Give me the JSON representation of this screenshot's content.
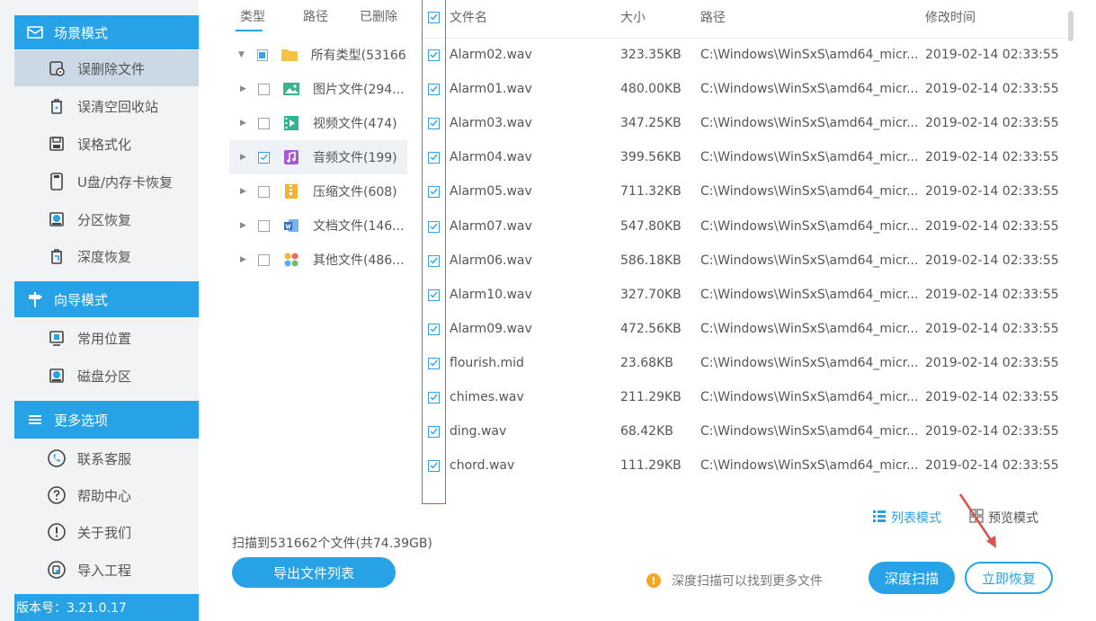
{
  "sidebar": {
    "scene_mode": {
      "title": "场景模式",
      "icon": "mail-icon"
    },
    "scene_items": [
      {
        "label": "误删除文件",
        "icon": "deleted-file-icon",
        "active": true
      },
      {
        "label": "误清空回收站",
        "icon": "recycle-bin-icon",
        "active": false
      },
      {
        "label": "误格式化",
        "icon": "format-icon",
        "active": false
      },
      {
        "label": "U盘/内存卡恢复",
        "icon": "usb-drive-icon",
        "active": false
      },
      {
        "label": "分区恢复",
        "icon": "partition-icon",
        "active": false
      },
      {
        "label": "深度恢复",
        "icon": "deep-recovery-icon",
        "active": false
      }
    ],
    "guide_mode": {
      "title": "向导模式",
      "icon": "signpost-icon"
    },
    "guide_items": [
      {
        "label": "常用位置",
        "icon": "common-location-icon"
      },
      {
        "label": "磁盘分区",
        "icon": "disk-partition-icon"
      }
    ],
    "more_options": {
      "title": "更多选项",
      "icon": "menu-icon"
    },
    "more_items": [
      {
        "label": "联系客服",
        "icon": "phone-icon"
      },
      {
        "label": "帮助中心",
        "icon": "help-icon"
      },
      {
        "label": "关于我们",
        "icon": "info-icon"
      },
      {
        "label": "导入工程",
        "icon": "import-icon"
      }
    ],
    "version": "版本号：3.21.0.17"
  },
  "tree": {
    "tabs": [
      "类型",
      "路径",
      "已删除"
    ],
    "items": [
      {
        "label": "所有类型(53166...",
        "icon": "folder-icon",
        "check": "partial",
        "expanded": true,
        "level": 0
      },
      {
        "label": "图片文件(294...",
        "icon": "image-file-icon",
        "check": "none",
        "level": 1
      },
      {
        "label": "视频文件(474)",
        "icon": "video-file-icon",
        "check": "none",
        "level": 1
      },
      {
        "label": "音频文件(199)",
        "icon": "audio-file-icon",
        "check": "checked",
        "level": 1,
        "selected": true
      },
      {
        "label": "压缩文件(608)",
        "icon": "archive-file-icon",
        "check": "none",
        "level": 1
      },
      {
        "label": "文档文件(146...",
        "icon": "document-file-icon",
        "check": "none",
        "level": 1
      },
      {
        "label": "其他文件(486...",
        "icon": "other-file-icon",
        "check": "none",
        "level": 1
      }
    ]
  },
  "table": {
    "columns": {
      "name": "文件名",
      "size": "大小",
      "path": "路径",
      "modified": "修改时间"
    },
    "rows": [
      {
        "name": "Alarm02.wav",
        "size": "323.35KB",
        "path": "C:\\Windows\\WinSxS\\amd64_micr...",
        "modified": "2019-02-14 02:33:55"
      },
      {
        "name": "Alarm01.wav",
        "size": "480.00KB",
        "path": "C:\\Windows\\WinSxS\\amd64_micr...",
        "modified": "2019-02-14 02:33:55"
      },
      {
        "name": "Alarm03.wav",
        "size": "347.25KB",
        "path": "C:\\Windows\\WinSxS\\amd64_micr...",
        "modified": "2019-02-14 02:33:55"
      },
      {
        "name": "Alarm04.wav",
        "size": "399.56KB",
        "path": "C:\\Windows\\WinSxS\\amd64_micr...",
        "modified": "2019-02-14 02:33:55"
      },
      {
        "name": "Alarm05.wav",
        "size": "711.32KB",
        "path": "C:\\Windows\\WinSxS\\amd64_micr...",
        "modified": "2019-02-14 02:33:55"
      },
      {
        "name": "Alarm07.wav",
        "size": "547.80KB",
        "path": "C:\\Windows\\WinSxS\\amd64_micr...",
        "modified": "2019-02-14 02:33:55"
      },
      {
        "name": "Alarm06.wav",
        "size": "586.18KB",
        "path": "C:\\Windows\\WinSxS\\amd64_micr...",
        "modified": "2019-02-14 02:33:55"
      },
      {
        "name": "Alarm10.wav",
        "size": "327.70KB",
        "path": "C:\\Windows\\WinSxS\\amd64_micr...",
        "modified": "2019-02-14 02:33:55"
      },
      {
        "name": "Alarm09.wav",
        "size": "472.56KB",
        "path": "C:\\Windows\\WinSxS\\amd64_micr...",
        "modified": "2019-02-14 02:33:55"
      },
      {
        "name": "flourish.mid",
        "size": "23.68KB",
        "path": "C:\\Windows\\WinSxS\\amd64_micr...",
        "modified": "2019-02-14 02:33:55"
      },
      {
        "name": "chimes.wav",
        "size": "211.29KB",
        "path": "C:\\Windows\\WinSxS\\amd64_micr...",
        "modified": "2019-02-14 02:33:55"
      },
      {
        "name": "ding.wav",
        "size": "68.42KB",
        "path": "C:\\Windows\\WinSxS\\amd64_micr...",
        "modified": "2019-02-14 02:33:55"
      },
      {
        "name": "chord.wav",
        "size": "111.29KB",
        "path": "C:\\Windows\\WinSxS\\amd64_micr...",
        "modified": "2019-02-14 02:33:55"
      }
    ]
  },
  "view_modes": {
    "list": "列表模式",
    "preview": "预览模式"
  },
  "scan_summary": "扫描到531662个文件(共74.39GB)",
  "buttons": {
    "export": "导出文件列表",
    "deep_scan": "深度扫描",
    "recover": "立即恢复"
  },
  "tip": "深度扫描可以找到更多文件",
  "colors": {
    "accent": "#27a2e6",
    "annotation": "#d9534f",
    "warning": "#f5a623"
  }
}
